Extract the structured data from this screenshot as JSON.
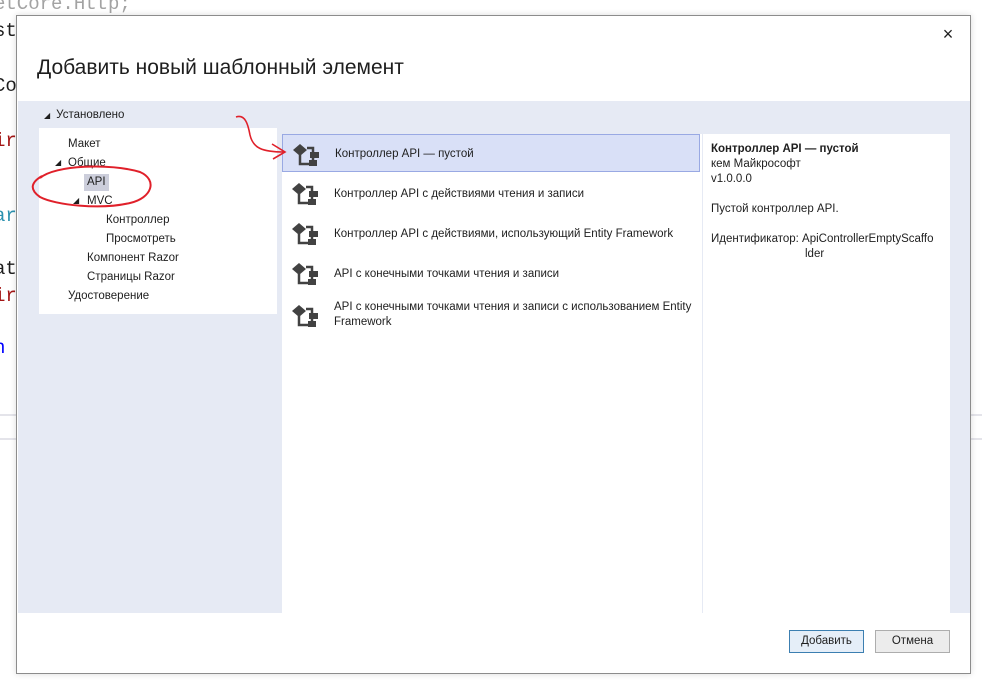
{
  "background_code": {
    "lines": [
      {
        "text": "etCore.Http;",
        "color": "#a3a3a3"
      },
      {
        "text": "st",
        "color": "#1e1e1e"
      },
      {
        "text": "Co",
        "color": "#1e1e1e"
      },
      {
        "text": "ire",
        "color": "#a31515"
      },
      {
        "text": "aro",
        "color": "#2b91af"
      },
      {
        "text": "ati",
        "color": "#1e1e1e"
      },
      {
        "text": "ire",
        "color": "#a31515"
      },
      {
        "text": "n",
        "color": "#0000ff"
      }
    ]
  },
  "dialog": {
    "title": "Добавить новый шаблонный элемент",
    "close_glyph": "×",
    "installed_label": "Установлено",
    "tree": [
      {
        "label": "Макет",
        "selected": false
      },
      {
        "label": "Общие",
        "selected": false
      },
      {
        "label": "API",
        "selected": true
      },
      {
        "label": "MVC",
        "selected": false
      },
      {
        "label": "Контроллер",
        "selected": false
      },
      {
        "label": "Просмотреть",
        "selected": false
      },
      {
        "label": "Компонент Razor",
        "selected": false
      },
      {
        "label": "Страницы Razor",
        "selected": false
      },
      {
        "label": "Удостоверение",
        "selected": false
      }
    ],
    "templates": [
      {
        "label": "Контроллер API — пустой",
        "icon": "api-controller-icon",
        "selected": true
      },
      {
        "label": "Контроллер API с действиями чтения и записи",
        "icon": "api-controller-icon",
        "selected": false
      },
      {
        "label": "Контроллер API с действиями, использующий Entity Framework",
        "icon": "api-controller-icon",
        "selected": false
      },
      {
        "label": "API с конечными точками чтения и записи",
        "icon": "api-controller-icon",
        "selected": false
      },
      {
        "label": "API с конечными точками чтения и записи с использованием Entity Framework",
        "icon": "api-controller-icon",
        "selected": false
      }
    ],
    "detail": {
      "title": "Контроллер API — пустой",
      "author": "кем Майкрософт",
      "version": "v1.0.0.0",
      "description": "Пустой контроллер API.",
      "identifier_line1": "Идентификатор: ApiControllerEmptyScaffo",
      "identifier_line2": "lder"
    },
    "buttons": {
      "add": "Добавить",
      "cancel": "Отмена"
    }
  },
  "annotation": {
    "color": "#e0202a"
  }
}
